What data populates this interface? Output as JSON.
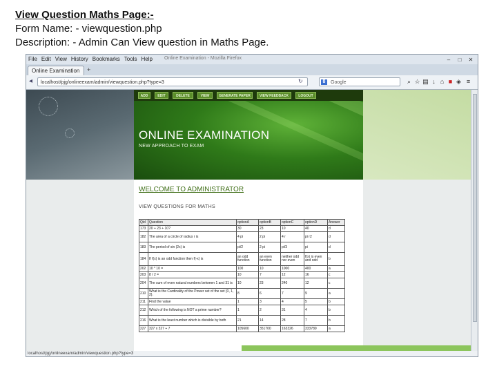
{
  "doc": {
    "title": "View Question Maths Page:-",
    "form_name": "Form Name: - viewquestion.php",
    "description": "Description: - Admin Can View question in Maths Page."
  },
  "browser": {
    "menu": [
      "File",
      "Edit",
      "View",
      "History",
      "Bookmarks",
      "Tools",
      "Help"
    ],
    "window_title": "Online Examination - Mozilla Firefox",
    "tab_label": "Online Examination",
    "url": "localhost/pjg/onlineexam/admin/viewquestion.php?type=3",
    "search_placeholder": "Google",
    "status_url": "localhost/pjg/onlineexam/admin/viewquestion.php?type=3"
  },
  "site": {
    "menu": [
      "ADD",
      "EDIT",
      "DELETE",
      "VIEW",
      "GENERATE PAPER",
      "VIEW FEEDBACK",
      "LOGOUT"
    ],
    "title": "ONLINE EXAMINATION",
    "subtitle": "NEW APPROACH TO EXAM",
    "welcome": "WELCOME TO ADMINISTRATOR",
    "view_header": "VIEW QUESTIONS FOR MATHS"
  },
  "table": {
    "columns": [
      "Qid",
      "Question",
      "optionA",
      "optionB",
      "optionC",
      "optionD",
      "Answer"
    ],
    "rows": [
      [
        "173",
        "20 + 23 + 10?",
        "30",
        "23",
        "10",
        "40",
        "d"
      ],
      [
        "182",
        "The area of a circle of radius r is",
        "4 pi",
        "2 pi",
        "4 r",
        "pi r2",
        "d"
      ],
      [
        "183",
        "The period of sin (2x) is",
        "pi/2",
        "2 pi",
        "pi/3",
        "pi",
        "d"
      ],
      [
        "184",
        "If f(x) is an odd function then f(-x) is",
        "an odd function",
        "an even function",
        "neither odd nor even",
        "f(x) is even and odd",
        "b"
      ],
      [
        "202",
        "10 * 10 =",
        "100",
        "10",
        "1000",
        "400",
        "a"
      ],
      [
        "203",
        "8 / 2 =",
        "10",
        "7",
        "12",
        "16",
        "c"
      ],
      [
        "204",
        "The sum of even natural numbers between 1 and 31 is",
        "10",
        "23",
        "240",
        "12",
        "c"
      ],
      [
        "210",
        "What is the Cardinality of the Power set of the set {0, 1, 2}.",
        "8",
        "6",
        "7",
        "9",
        "a"
      ],
      [
        "211",
        "Find the value",
        "1",
        "3",
        "4",
        "5",
        "b"
      ],
      [
        "212",
        "Which of the following is NOT a prime number?",
        "1",
        "2",
        "31",
        "4",
        "b"
      ],
      [
        "216",
        "What is the least number which is divisible by both",
        "21",
        "14",
        "28",
        "7",
        "b"
      ],
      [
        "227",
        "327 x 327 + 7",
        "105600",
        "351700",
        "163326",
        "333789",
        "a"
      ]
    ]
  }
}
